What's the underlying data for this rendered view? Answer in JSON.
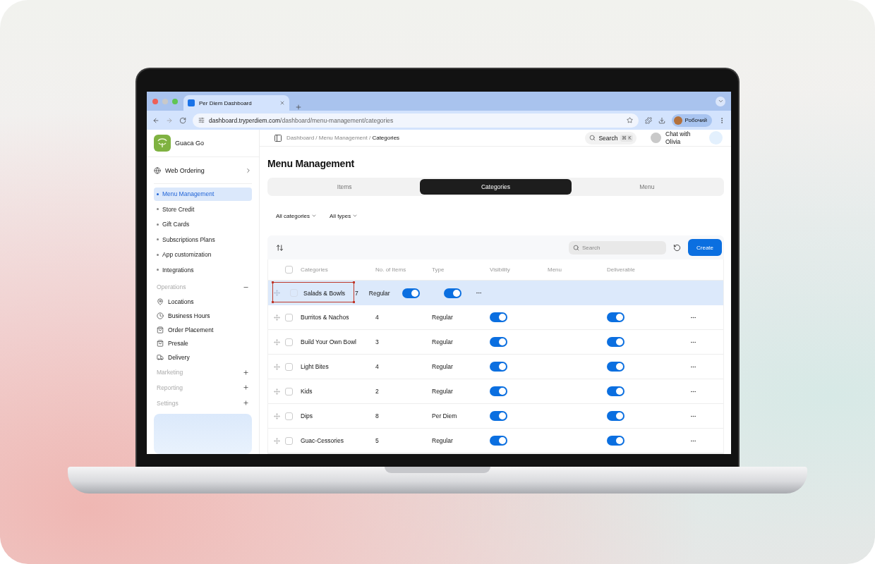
{
  "browser": {
    "tabs": [
      {
        "title": "Per Diem Dashboard",
        "selected": true
      }
    ],
    "url_host": "dashboard.tryperdiem.com",
    "url_path": "/dashboard/menu-management/categories",
    "profile": "Робочий"
  },
  "sidebar": {
    "brand": "Guaca Go",
    "web_ordering": "Web Ordering",
    "items": [
      {
        "label": "Menu Management",
        "selected": true
      },
      {
        "label": "Store Credit",
        "selected": false
      },
      {
        "label": "Gift Cards",
        "selected": false
      },
      {
        "label": "Subscriptions Plans",
        "selected": false
      },
      {
        "label": "App customization",
        "selected": false
      },
      {
        "label": "Integrations",
        "selected": false
      }
    ],
    "sections": [
      {
        "title": "Operations",
        "expanded": true,
        "items": [
          "Locations",
          "Business Hours",
          "Order Placement",
          "Presale",
          "Delivery"
        ]
      },
      {
        "title": "Marketing",
        "expanded": false
      },
      {
        "title": "Reporting",
        "expanded": false
      },
      {
        "title": "Settings",
        "expanded": false
      }
    ]
  },
  "header": {
    "breadcrumb": "Dashboard / Menu Management / **Categories**",
    "search": "Search",
    "shortcut": "⌘ K",
    "chat": "Chat with Olivia"
  },
  "title": "Menu Management",
  "tabs": [
    {
      "label": "Items",
      "selected": false
    },
    {
      "label": "Categories",
      "selected": true
    },
    {
      "label": "Menu",
      "selected": false
    }
  ],
  "filters": [
    "All categories",
    "All types"
  ],
  "toolbar": {
    "search_placeholder": "Search",
    "create": "Create"
  },
  "table": {
    "all_checked": false,
    "columns": [
      "Categories",
      "No. of Items",
      "Type",
      "Visibility",
      "Menu",
      "Deliverable"
    ],
    "dragged_row": {
      "name": "Salads & Bowls",
      "count": "7",
      "kind_label": "Regular",
      "checked": false,
      "switch_1": true,
      "switch_2": true,
      "selected": true
    },
    "rows": [
      {
        "name": "Burritos & Nachos",
        "items": "4",
        "type": "Regular",
        "checked": false,
        "visible": true,
        "deliverable": true
      },
      {
        "name": "Build Your Own Bowl",
        "items": "3",
        "type": "Regular",
        "checked": false,
        "visible": true,
        "deliverable": true
      },
      {
        "name": "Light Bites",
        "items": "4",
        "type": "Regular",
        "checked": false,
        "visible": true,
        "deliverable": true
      },
      {
        "name": "Kids",
        "items": "2",
        "type": "Regular",
        "checked": false,
        "visible": true,
        "deliverable": true
      },
      {
        "name": "Dips",
        "items": "8",
        "type": "Per Diem",
        "checked": false,
        "visible": true,
        "deliverable": true
      },
      {
        "name": "Guac-Cessories",
        "items": "5",
        "type": "Regular",
        "checked": false,
        "visible": true,
        "deliverable": true
      }
    ]
  }
}
